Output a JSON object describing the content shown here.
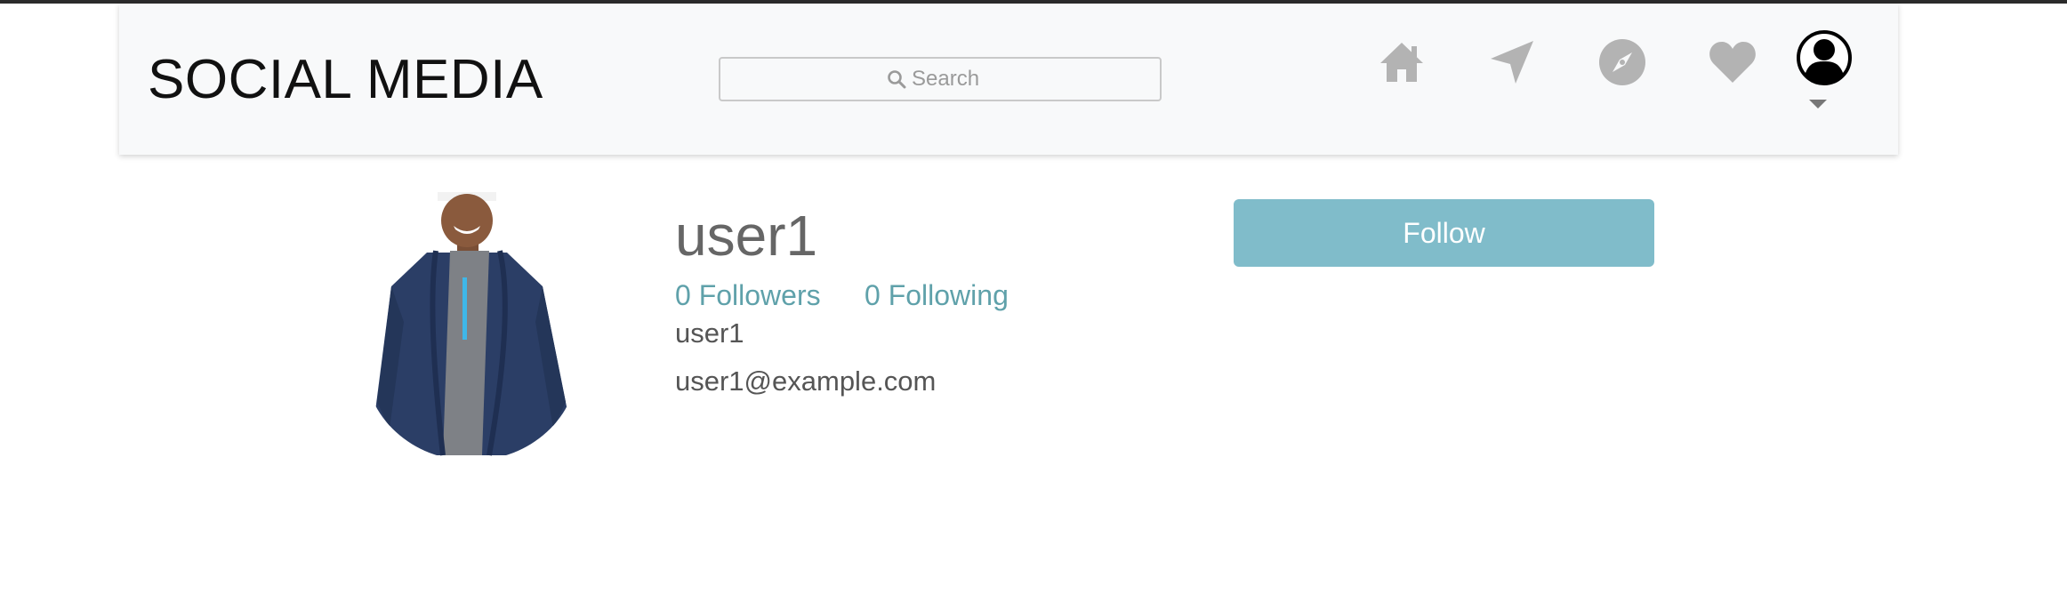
{
  "navbar": {
    "brand": "SOCIAL MEDIA",
    "search_placeholder": "Search",
    "icons": [
      "home-icon",
      "send-icon",
      "explore-icon",
      "heart-icon",
      "profile-icon"
    ],
    "icon_color": "#b3b3b3"
  },
  "profile": {
    "username": "user1",
    "followers_text": "0 Followers",
    "following_text": "0 Following",
    "name": "user1",
    "email": "user1@example.com",
    "follow_label": "Follow"
  },
  "colors": {
    "accent": "#80bcca",
    "link": "#5fa1aa",
    "navbar_bg": "#f8f9fa"
  }
}
